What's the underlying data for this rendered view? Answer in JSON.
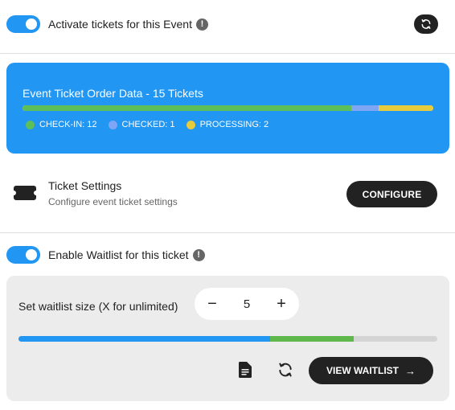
{
  "activate": {
    "label": "Activate tickets for this Event",
    "enabled": true,
    "info_icon": "!"
  },
  "refresh_icon": "refresh-icon",
  "order_data": {
    "title": "Event Ticket Order Data - 15 Tickets",
    "total": 15,
    "segments": [
      {
        "label": "CHECK-IN: 12",
        "value": 12,
        "color": "#5cbf5a"
      },
      {
        "label": "CHECKED: 1",
        "value": 1,
        "color": "#7fa5f5"
      },
      {
        "label": "PROCESSING: 2",
        "value": 2,
        "color": "#e6cc3c"
      }
    ]
  },
  "ticket_settings": {
    "title": "Ticket Settings",
    "subtitle": "Configure event ticket settings",
    "button_label": "CONFIGURE"
  },
  "waitlist": {
    "toggle_label": "Enable Waitlist for this ticket",
    "enabled": true,
    "info_icon": "!",
    "size_label": "Set waitlist size (X for unlimited)",
    "size_value": "5",
    "decrement_label": "−",
    "increment_label": "+",
    "progress": [
      {
        "fraction": 0.6,
        "color": "#2196f3"
      },
      {
        "fraction": 0.2,
        "color": "#5fb84b"
      }
    ],
    "view_label": "VIEW WAITLIST",
    "view_arrow": "→"
  },
  "colors": {
    "accent": "#2196f3",
    "dark_button": "#222222",
    "card_gray": "#ececec"
  }
}
